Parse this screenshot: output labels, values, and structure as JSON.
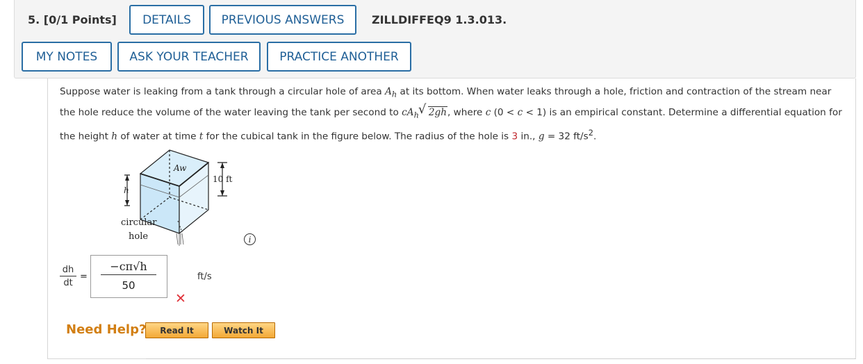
{
  "question": {
    "label": "5.  [0/1 Points]",
    "code": "ZILLDIFFEQ9 1.3.013."
  },
  "toolbar": {
    "details": "DETAILS",
    "previous_answers": "PREVIOUS ANSWERS",
    "my_notes": "MY NOTES",
    "ask_teacher": "ASK YOUR TEACHER",
    "practice_another": "PRACTICE ANOTHER"
  },
  "problem": {
    "radius_value": "3"
  },
  "figure": {
    "aw_label": "Aw",
    "height_label": "10 ft",
    "h_label": "h",
    "hole_label_1": "circular",
    "hole_label_2": "hole"
  },
  "answer": {
    "lhs_num": "dh",
    "lhs_den": "dt",
    "equals": "=",
    "numerator": "−cπ√h",
    "denominator": "50",
    "unit": "ft/s",
    "status": "incorrect"
  },
  "help": {
    "label": "Need Help?",
    "read_it": "Read It",
    "watch_it": "Watch It"
  },
  "colors": {
    "button_border": "#2a6ea5",
    "red_value": "#c0282e",
    "help_orange": "#d27f14",
    "incorrect_mark": "#e0343b"
  }
}
